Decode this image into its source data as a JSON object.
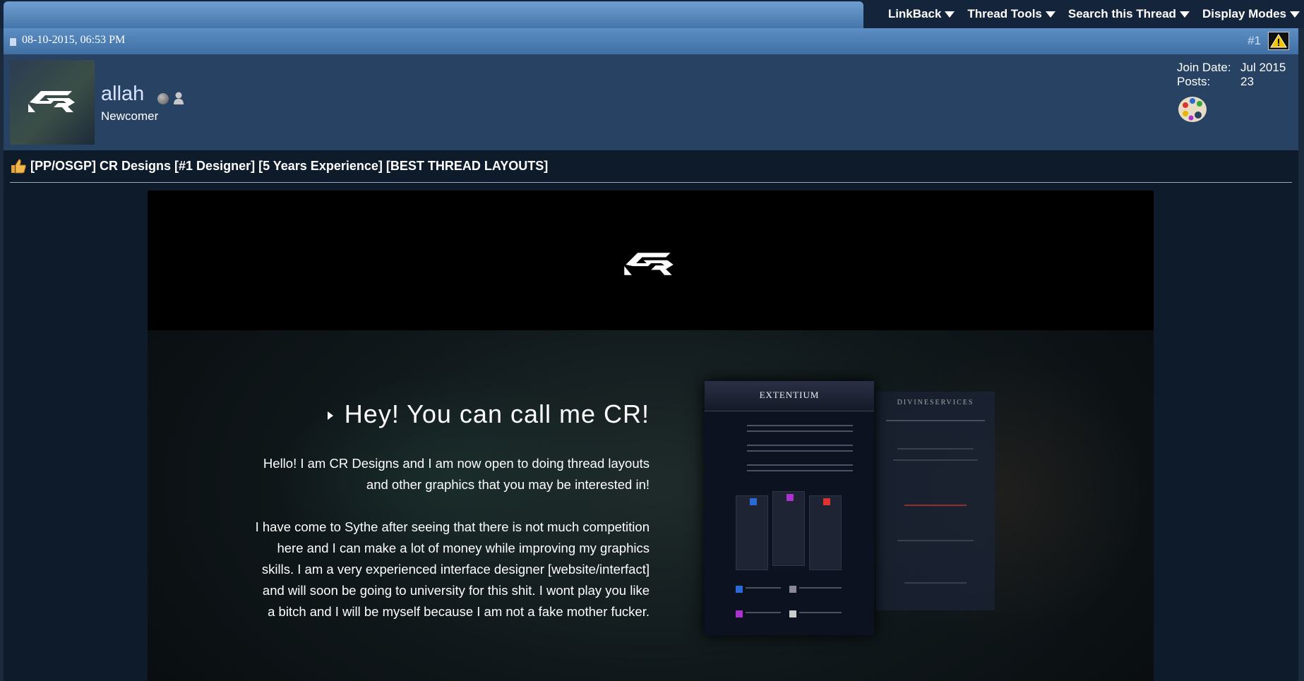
{
  "toolbar": {
    "menu": [
      {
        "label": "LinkBack"
      },
      {
        "label": "Thread Tools"
      },
      {
        "label": "Search this Thread"
      },
      {
        "label": "Display Modes"
      }
    ]
  },
  "post": {
    "date": "08-10-2015, 06:53 PM",
    "number": "#1"
  },
  "user": {
    "name": "allah",
    "title": "Newcomer",
    "join_date_label": "Join Date:",
    "join_date": "Jul 2015",
    "posts_label": "Posts:",
    "posts": "23"
  },
  "thread": {
    "title": "[PP/OSGP] CR Designs [#1 Designer] [5 Years Experience] [BEST THREAD LAYOUTS]"
  },
  "banner": {
    "heading": "Hey! You can call me CR!",
    "paragraph1": "Hello! I am CR Designs and I am now open to doing thread layouts and other graphics that you may be interested in!",
    "paragraph2": "I have come to Sythe after seeing that there is not much competition here and I can make a lot of money while improving my graphics skills. I am a very experienced interface designer [website/interfact] and will soon be going to university for this shit. I wont play you like a bitch and I will be myself because I am not a fake mother fucker.",
    "mockup1_title": "EXTENTIUM",
    "mockup2_title": "DIVINESERVICES"
  },
  "colors": {
    "page_bg": "#1b2a3c",
    "toolbar_blue": "#5d8fc4",
    "user_panel": "#274262",
    "content_bg": "#0e1b2a",
    "link": "#cfe0ff"
  },
  "icons": [
    "caret-down-icon",
    "post-icon",
    "report-icon",
    "status-offline-icon",
    "person-icon",
    "palette-icon",
    "thumbs-up-icon",
    "cr-logo-icon"
  ]
}
